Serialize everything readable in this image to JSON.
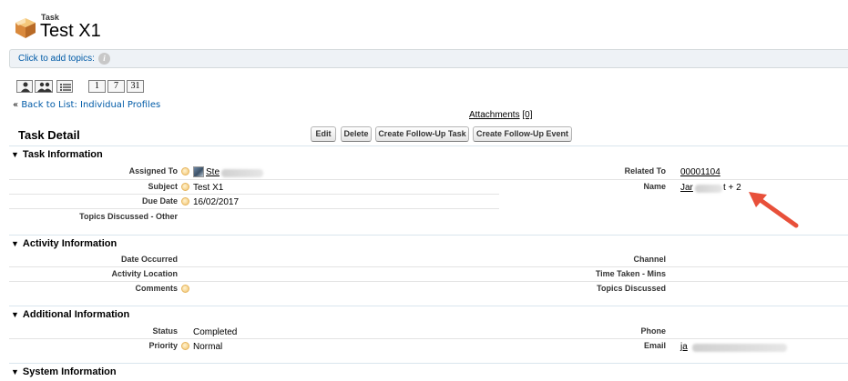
{
  "header": {
    "object_type": "Task",
    "record_name": "Test X1"
  },
  "topics": {
    "label": "Click to add topics:",
    "info_glyph": "i"
  },
  "calendar_views": [
    "1",
    "7",
    "31"
  ],
  "back_link": {
    "prefix": "«",
    "label": "Back to List: Individual Profiles"
  },
  "attachments": {
    "label": "Attachments",
    "count": "[0]"
  },
  "detail": {
    "title": "Task Detail",
    "buttons": {
      "edit": "Edit",
      "delete": "Delete",
      "follow_up_task": "Create Follow-Up Task",
      "follow_up_event": "Create Follow-Up Event"
    }
  },
  "sections": {
    "task_info": {
      "title": "Task Information",
      "assigned_to_label": "Assigned To",
      "assigned_to_value": "Ste",
      "subject_label": "Subject",
      "subject_value": "Test X1",
      "due_date_label": "Due Date",
      "due_date_value": "16/02/2017",
      "topics_label": "Topics Discussed - Other",
      "related_to_label": "Related To",
      "related_to_value": "00001104",
      "name_label": "Name",
      "name_value_start": "Jar",
      "name_value_end": "t + 2"
    },
    "activity_info": {
      "title": "Activity Information",
      "date_occurred_label": "Date Occurred",
      "activity_location_label": "Activity Location",
      "comments_label": "Comments",
      "channel_label": "Channel",
      "time_taken_label": "Time Taken - Mins",
      "topics_discussed_label": "Topics Discussed"
    },
    "additional_info": {
      "title": "Additional Information",
      "status_label": "Status",
      "status_value": "Completed",
      "priority_label": "Priority",
      "priority_value": "Normal",
      "phone_label": "Phone",
      "email_label": "Email",
      "email_value": "ja"
    },
    "system_info": {
      "title": "System Information"
    }
  },
  "annotation": {
    "arrow_color": "#e8503a"
  },
  "colors": {
    "link": "#015ba7",
    "section_rule": "#d9e6ee",
    "topics_bar": "#eef2f6"
  }
}
